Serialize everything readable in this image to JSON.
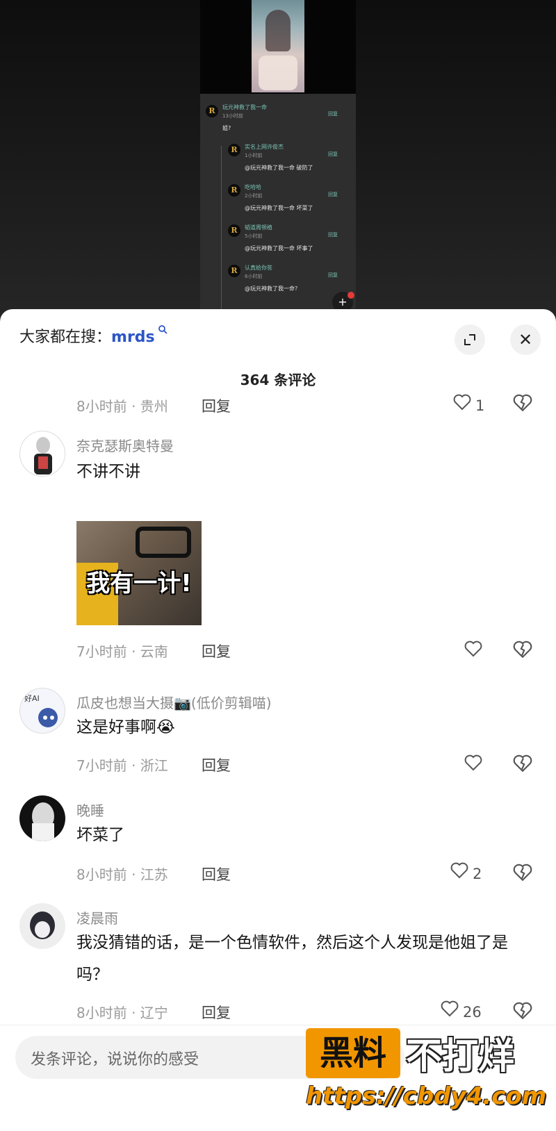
{
  "video": {
    "embedded_comments": [
      {
        "name": "玩元神救了我一命",
        "time": "13小时前",
        "text": "姐?",
        "reply": "回复"
      },
      {
        "name": "实名上网许俊杰",
        "time": "1小时前",
        "text": "@玩元神救了我一命 破防了",
        "reply": "回复"
      },
      {
        "name": "吃哈哈",
        "time": "2小时前",
        "text": "@玩元神救了我一命 坏菜了",
        "reply": "回复"
      },
      {
        "name": "韬道周顿植",
        "time": "5小时前",
        "text": "@玩元神救了我一命 坏事了",
        "reply": "回复"
      },
      {
        "name": "认真给你答",
        "time": "6小时前",
        "text": "@玩元神救了我一命？",
        "reply": "回复"
      }
    ],
    "avatar_letter": "R"
  },
  "sheet": {
    "search_prefix": "大家都在搜：",
    "search_keyword": "mrds",
    "search_icon": "search-icon",
    "expand_icon": "expand-icon",
    "close_icon": "✕",
    "comment_count": "364 条评论"
  },
  "comments": [
    {
      "nick": "",
      "body": "",
      "time_loc": "8小时前 · 贵州",
      "reply": "回复",
      "likes": "1"
    },
    {
      "nick": "奈克瑟斯奥特曼",
      "body": "不讲不讲",
      "meme_text": "我有一计!",
      "time_loc": "7小时前 · 云南",
      "reply": "回复",
      "likes": ""
    },
    {
      "nick": "瓜皮也想当大摄📷(低价剪辑喵)",
      "body": "这是好事啊😭",
      "avatar_badge": "好AI",
      "time_loc": "7小时前 · 浙江",
      "reply": "回复",
      "likes": ""
    },
    {
      "nick": "晚睡",
      "body": "坏菜了",
      "time_loc": "8小时前 · 江苏",
      "reply": "回复",
      "likes": "2"
    },
    {
      "nick": "凌晨雨",
      "body": "我没猜错的话，是一个色情软件，然后这个人发现是他姐了是吗？",
      "time_loc": "8小时前 · 辽宁",
      "reply": "回复",
      "likes": "26"
    }
  ],
  "input": {
    "placeholder": "发条评论，说说你的感受"
  },
  "watermark": {
    "box_text": "黑料",
    "right_text": "不打烊",
    "url": "https://cbdy4.com",
    "box_color": "#f29600"
  },
  "colors": {
    "search_keyword": "#2c55c6",
    "embedded_name": "#7ac3b4"
  }
}
